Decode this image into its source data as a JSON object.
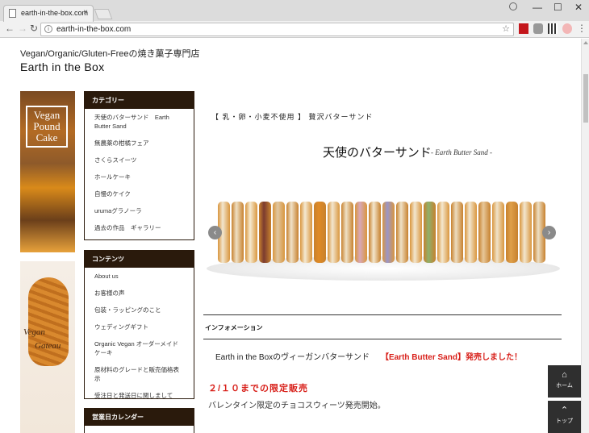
{
  "browser": {
    "tab_title": "earth-in-the-box.com",
    "tab_close": "×",
    "url": "earth-in-the-box.com",
    "window_controls": {
      "minimize": "—",
      "maximize": "☐",
      "close": "✕"
    },
    "nav": {
      "back": "←",
      "forward": "→",
      "reload": "↻"
    },
    "star": "☆",
    "menu": "⋮",
    "info": "i"
  },
  "site": {
    "tagline": "Vegan/Organic/Gluten-Freeの焼き菓子専門店",
    "title": "Earth in the Box"
  },
  "banners": {
    "pound_cake": "Vegan Pound Cake",
    "gateau_line1": "Vegan",
    "gateau_line2": "Gateau"
  },
  "sidebar": {
    "categories": {
      "heading": "カテゴリー",
      "items": [
        {
          "label": "天使のバターサンド　Earth Butter Sand"
        },
        {
          "label": "無農薬の柑橘フェア"
        },
        {
          "label": "さくらスイーツ"
        },
        {
          "label": "ホールケーキ"
        },
        {
          "label": "自慢のケイク"
        },
        {
          "label": "urumaグラノーラ"
        },
        {
          "label": "過去の作品　ギャラリー"
        }
      ]
    },
    "contents": {
      "heading": "コンテンツ",
      "items": [
        {
          "label": "About us"
        },
        {
          "label": "お客様の声"
        },
        {
          "label": "包装・ラッピングのこと"
        },
        {
          "label": "ウェディングギフト"
        },
        {
          "label": "Organic Vegan オーダーメイドケーキ"
        },
        {
          "label": "原材料のグレードと販売価格表示"
        },
        {
          "label": "受注日と発送日に関しまして"
        }
      ]
    },
    "calendar": {
      "heading": "営業日カレンダー"
    }
  },
  "main": {
    "headline": "【 乳・卵・小麦不使用 】 贅沢バターサンド",
    "hero_title": "天使のバターサンド",
    "hero_sub": "- Earth Butter Sand -",
    "slider_prev": "‹",
    "slider_next": "›",
    "info_heading": "インフォメーション",
    "news_text": "Earth in the Boxのヴィーガンバターサンド",
    "news_highlight": "【Earth Butter Sand】発売しました！",
    "limited": "２/１０までの限定販売",
    "valentine": "バレンタイン限定のチョコスウィーツ発売開始。"
  },
  "floating": {
    "home_icon": "⌂",
    "home_label": "ホーム",
    "top_icon": "⌃",
    "top_label": "トップ"
  },
  "colors": {
    "widget_header": "#2a1a0c",
    "highlight_red": "#d8201a",
    "float_button": "#2f2f2f"
  }
}
